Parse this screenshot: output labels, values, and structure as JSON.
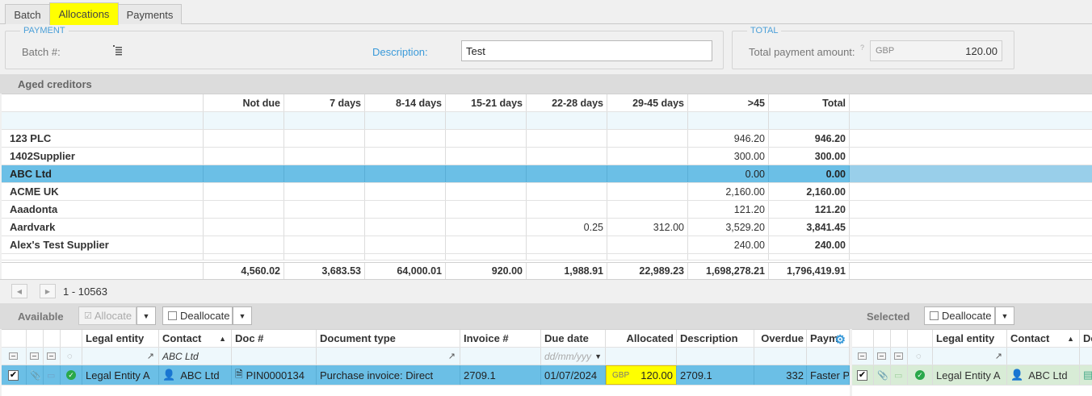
{
  "tabs": [
    {
      "label": "Batch"
    },
    {
      "label": "Allocations"
    },
    {
      "label": "Payments"
    }
  ],
  "payment": {
    "legend": "PAYMENT",
    "batch_label": "Batch #:",
    "description_label": "Description:",
    "description_value": "Test"
  },
  "total": {
    "legend": "TOTAL",
    "label": "Total payment amount:",
    "currency": "GBP",
    "amount": "120.00"
  },
  "aged": {
    "title": "Aged creditors",
    "columns": [
      "",
      "Not due",
      "7 days",
      "8-14 days",
      "15-21 days",
      "22-28 days",
      "29-45 days",
      ">45",
      "Total"
    ],
    "rows": [
      [
        "123 PLC",
        "",
        "",
        "",
        "",
        "",
        "",
        "946.20",
        "946.20"
      ],
      [
        "1402Supplier",
        "",
        "",
        "",
        "",
        "",
        "",
        "300.00",
        "300.00"
      ],
      [
        "ABC Ltd",
        "",
        "",
        "",
        "",
        "",
        "",
        "0.00",
        "0.00"
      ],
      [
        "ACME UK",
        "",
        "",
        "",
        "",
        "",
        "",
        "2,160.00",
        "2,160.00"
      ],
      [
        "Aaadonta",
        "",
        "",
        "",
        "",
        "",
        "",
        "121.20",
        "121.20"
      ],
      [
        "Aardvark",
        "",
        "",
        "",
        "",
        "0.25",
        "312.00",
        "3,529.20",
        "3,841.45"
      ],
      [
        "Alex's Test Supplier",
        "",
        "",
        "",
        "",
        "",
        "",
        "240.00",
        "240.00"
      ]
    ],
    "footer": [
      "",
      "4,560.02",
      "3,683.53",
      "64,000.01",
      "920.00",
      "1,988.91",
      "22,989.23",
      "1,698,278.21",
      "1,796,419.91"
    ],
    "pager": "1 - 10563"
  },
  "available": {
    "title": "Available",
    "allocate_label": "Allocate",
    "deallocate_label": "Deallocate",
    "columns": [
      "Legal entity",
      "Contact",
      "Doc #",
      "Document type",
      "Invoice #",
      "Due date",
      "Allocated",
      "Description",
      "Overdue",
      "Paym"
    ],
    "filter_contact": "ABC Ltd",
    "filter_date_placeholder": "dd/mm/yyy",
    "row": {
      "legal_entity": "Legal Entity A",
      "contact": "ABC Ltd",
      "doc": "PIN0000134",
      "doc_type": "Purchase invoice: Direct",
      "invoice": "2709.1",
      "due_date": "01/07/2024",
      "currency": "GBP",
      "allocated": "120.00",
      "description": "2709.1",
      "overdue": "332",
      "payment": "Faster Pa"
    }
  },
  "selected": {
    "title": "Selected",
    "deallocate_label": "Deallocate",
    "columns": [
      "Legal entity",
      "Contact",
      "De"
    ],
    "row": {
      "legal_entity": "Legal Entity A",
      "contact": "ABC Ltd"
    }
  }
}
